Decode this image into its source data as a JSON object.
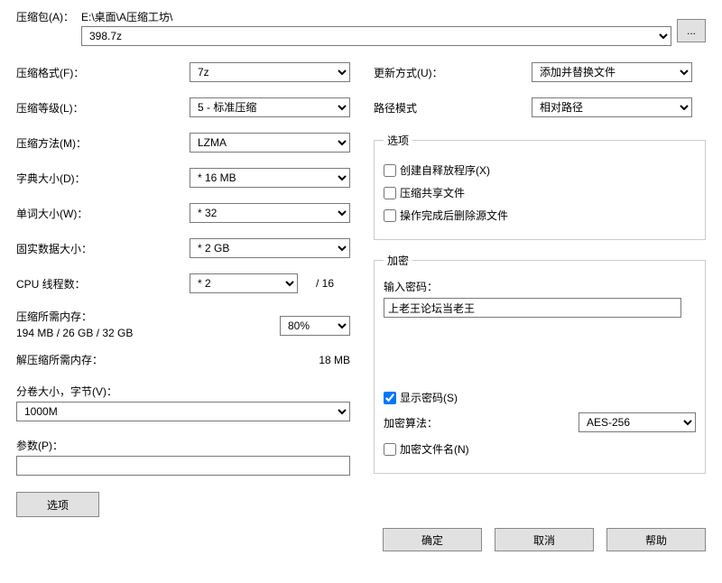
{
  "archive": {
    "label": "压缩包(A)：",
    "path": "E:\\桌面\\A压缩工坊\\",
    "filename": "398.7z",
    "browse": "..."
  },
  "left": {
    "format_label": "压缩格式(F)：",
    "format_value": "7z",
    "level_label": "压缩等级(L)：",
    "level_value": "5 - 标准压缩",
    "method_label": "压缩方法(M)：",
    "method_value": "LZMA",
    "dict_label": "字典大小(D)：",
    "dict_value": "* 16 MB",
    "word_label": "单词大小(W)：",
    "word_value": "* 32",
    "solid_label": "固实数据大小：",
    "solid_value": "* 2 GB",
    "cpu_label": "CPU 线程数：",
    "cpu_value": "* 2",
    "cpu_total": "/ 16",
    "mem_label": "压缩所需内存：",
    "mem_value": "194 MB / 26 GB / 32 GB",
    "mem_percent": "80%",
    "decomp_label": "解压缩所需内存：",
    "decomp_value": "18 MB",
    "volume_label": "分卷大小，字节(V)：",
    "volume_value": "1000M",
    "param_label": "参数(P)：",
    "param_value": "",
    "options_btn": "选项"
  },
  "right": {
    "update_label": "更新方式(U)：",
    "update_value": "添加并替换文件",
    "pathmode_label": "路径模式",
    "pathmode_value": "相对路径",
    "options_legend": "选项",
    "opt_sfx": "创建自释放程序(X)",
    "opt_shared": "压缩共享文件",
    "opt_delete": "操作完成后删除源文件",
    "enc_legend": "加密",
    "enc_pw_label": "输入密码：",
    "enc_pw_value": "上老王论坛当老王",
    "enc_show_pw": "显示密码(S)",
    "enc_algo_label": "加密算法：",
    "enc_algo_value": "AES-256",
    "enc_names": "加密文件名(N)"
  },
  "footer": {
    "ok": "确定",
    "cancel": "取消",
    "help": "帮助"
  }
}
